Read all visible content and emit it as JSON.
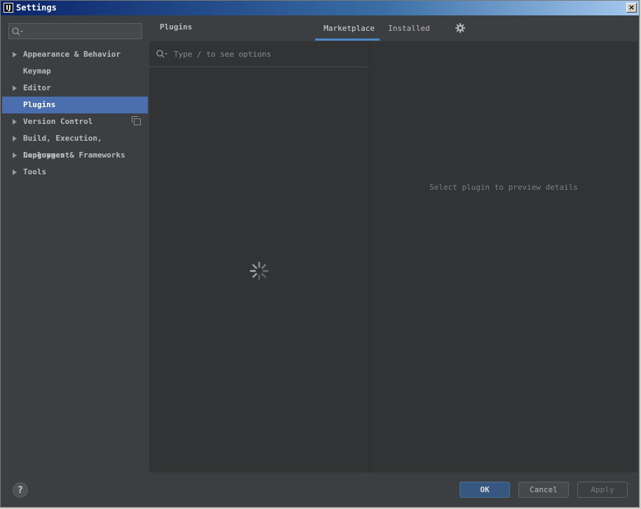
{
  "window": {
    "title": "Settings",
    "icon_text": "IJ",
    "close_label": "×"
  },
  "sidebar": {
    "search": {
      "placeholder": ""
    },
    "items": [
      {
        "label": "Appearance & Behavior",
        "expandable": true
      },
      {
        "label": "Keymap",
        "expandable": false
      },
      {
        "label": "Editor",
        "expandable": true
      },
      {
        "label": "Plugins",
        "expandable": false,
        "active": true
      },
      {
        "label": "Version Control",
        "expandable": true
      },
      {
        "label": "Build, Execution, Deployment",
        "expandable": true
      },
      {
        "label": "Languages & Frameworks",
        "expandable": true
      },
      {
        "label": "Tools",
        "expandable": true
      }
    ]
  },
  "header": {
    "title": "Plugins",
    "tabs": [
      {
        "label": "Marketplace",
        "active": true
      },
      {
        "label": "Installed",
        "active": false
      }
    ]
  },
  "list": {
    "search_placeholder": "Type / to see options"
  },
  "detail": {
    "empty_text": "Select plugin to preview details"
  },
  "footer": {
    "help": "?",
    "ok": "OK",
    "cancel": "Cancel",
    "apply": "Apply"
  },
  "colors": {
    "accent": "#4b6eaf",
    "tab_underline": "#4a88c7",
    "background": "#3c3f41"
  }
}
